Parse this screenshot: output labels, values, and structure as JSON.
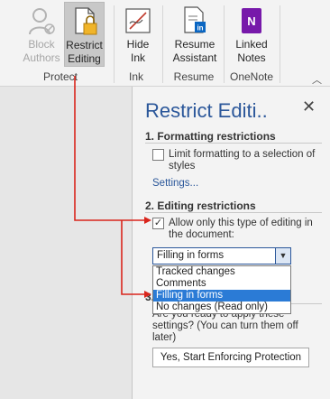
{
  "ribbon": {
    "block_authors": "Block\nAuthors",
    "restrict_editing": "Restrict\nEditing",
    "hide_ink": "Hide\nInk",
    "resume_assistant": "Resume\nAssistant",
    "linked_notes": "Linked\nNotes",
    "groups": {
      "protect": "Protect",
      "ink": "Ink",
      "resume": "Resume",
      "onenote": "OneNote"
    }
  },
  "pane": {
    "title": "Restrict Editi..",
    "section1": "1. Formatting restrictions",
    "limit_formatting": "Limit formatting to a selection of styles",
    "settings_link": "Settings...",
    "section2": "2. Editing restrictions",
    "allow_only": "Allow only this type of editing in the document:",
    "allow_only_checked": true,
    "combo_value": "Filling in forms",
    "options": [
      "Tracked changes",
      "Comments",
      "Filling in forms",
      "No changes (Read only)"
    ],
    "selected_option": "Filling in forms",
    "section3_num": "3.",
    "apply_question": "Are you ready to apply these settings? (You can turn them off later)",
    "start_button": "Yes, Start Enforcing Protection"
  },
  "colors": {
    "accent": "#2b579a",
    "arrow": "#d9251c",
    "selection": "#2b7bd6"
  }
}
